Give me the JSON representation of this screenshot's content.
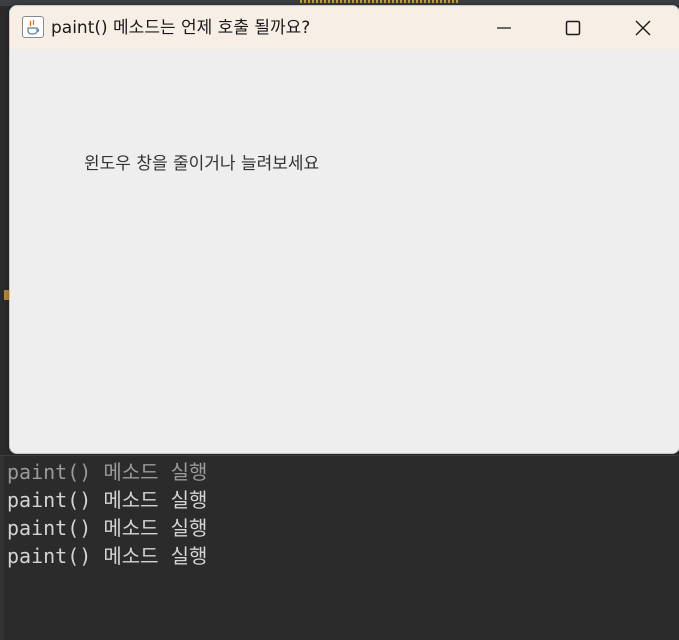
{
  "window": {
    "title": "paint() 메소드는 언제 호출 될까요?",
    "icon": "java-app-icon",
    "controls": {
      "minimize": "minimize-icon",
      "maximize": "maximize-icon",
      "close": "close-icon"
    }
  },
  "content": {
    "label": "윈도우 창을 줄이거나 늘려보세요"
  },
  "console": {
    "lines": [
      "paint() 메소드 실행",
      "paint() 메소드 실행",
      "paint() 메소드 실행",
      "paint() 메소드 실행"
    ]
  },
  "colors": {
    "titlebar": "#f7efe6",
    "window_bg": "#eeeeee",
    "console_bg": "#2b2b2b",
    "console_text": "#d4d4d4"
  }
}
